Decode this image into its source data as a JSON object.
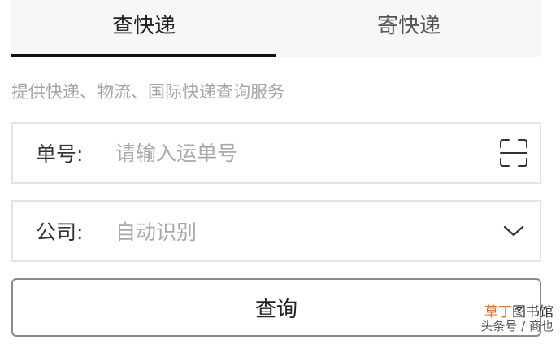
{
  "tabs": [
    {
      "label": "查快递",
      "active": true
    },
    {
      "label": "寄快递",
      "active": false
    }
  ],
  "subtitle": "提供快递、物流、国际快递查询服务",
  "tracking_field": {
    "label": "单号:",
    "value": "",
    "placeholder": "请输入运单号",
    "icon": "scan-icon"
  },
  "company_field": {
    "label": "公司:",
    "selected": "自动识别",
    "icon": "chevron-down-icon"
  },
  "query_button": {
    "label": "查询"
  },
  "watermark": {
    "accent": "草丁",
    "rest": "图书馆",
    "line2": "头条号 / 商也"
  },
  "colors": {
    "text": "#333333",
    "placeholder": "#a8a8a8",
    "tab_bg": "#f7f7f7",
    "tab_indicator": "#111111",
    "border": "#e4e4e4",
    "button_border": "#8a8a8a",
    "watermark_accent": "#e0752c"
  }
}
